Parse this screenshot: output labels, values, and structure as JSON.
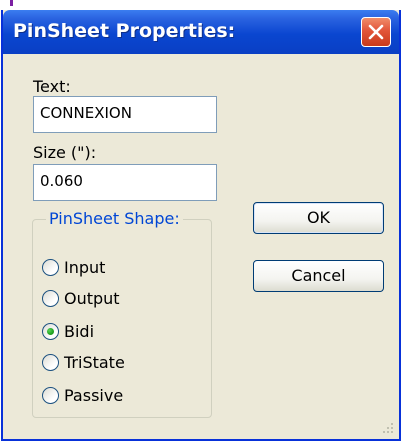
{
  "window": {
    "title": "PinSheet Properties:",
    "close_icon": "close-icon"
  },
  "form": {
    "text_label": "Text:",
    "text_value": "CONNEXION",
    "size_label": "Size (\"):",
    "size_value": "0.060"
  },
  "shape_group": {
    "title": "PinSheet Shape:",
    "options": [
      {
        "label": "Input",
        "selected": false
      },
      {
        "label": "Output",
        "selected": false
      },
      {
        "label": "Bidi",
        "selected": true
      },
      {
        "label": "TriState",
        "selected": false
      },
      {
        "label": "Passive",
        "selected": false
      }
    ]
  },
  "buttons": {
    "ok_label": "OK",
    "cancel_label": "Cancel"
  },
  "colors": {
    "titlebar": "#0a46d0",
    "dialog_bg": "#ece9d8",
    "close_button": "#e2553a",
    "group_title": "#0046d5",
    "radio_selected": "#21a121"
  }
}
